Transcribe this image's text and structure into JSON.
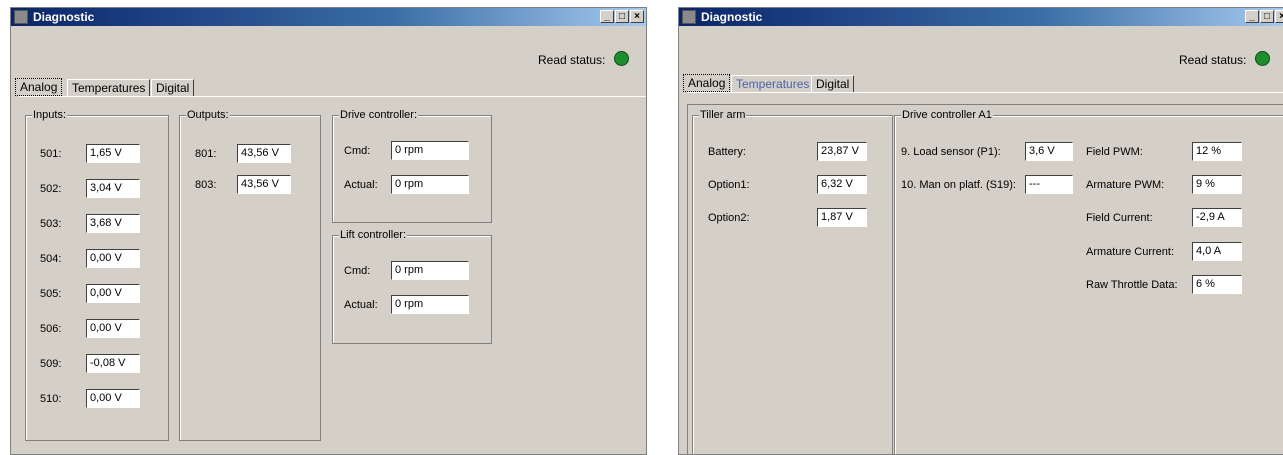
{
  "left": {
    "title": "Diagnostic",
    "read_status_label": "Read status:",
    "status_color": "#1a8f2c",
    "tabs": {
      "analog": "Analog",
      "temperatures": "Temperatures",
      "digital": "Digital"
    },
    "inputs": {
      "title": "Inputs:",
      "rows": [
        {
          "label": "501:",
          "value": "1,65 V"
        },
        {
          "label": "502:",
          "value": "3,04 V"
        },
        {
          "label": "503:",
          "value": "3,68 V"
        },
        {
          "label": "504:",
          "value": "0,00 V"
        },
        {
          "label": "505:",
          "value": "0,00 V"
        },
        {
          "label": "506:",
          "value": "0,00 V"
        },
        {
          "label": "509:",
          "value": "-0,08 V"
        },
        {
          "label": "510:",
          "value": "0,00 V"
        }
      ]
    },
    "outputs": {
      "title": "Outputs:",
      "rows": [
        {
          "label": "801:",
          "value": "43,56 V"
        },
        {
          "label": "803:",
          "value": "43,56 V"
        }
      ]
    },
    "drive_controller": {
      "title": "Drive controller:",
      "cmd_label": "Cmd:",
      "cmd_value": "0 rpm",
      "actual_label": "Actual:",
      "actual_value": "0 rpm"
    },
    "lift_controller": {
      "title": "Lift controller:",
      "cmd_label": "Cmd:",
      "cmd_value": "0 rpm",
      "actual_label": "Actual:",
      "actual_value": "0 rpm"
    }
  },
  "right": {
    "title": "Diagnostic",
    "read_status_label": "Read status:",
    "status_color": "#1a8f2c",
    "tabs": {
      "analog": "Analog",
      "temperatures": "Temperatures",
      "digital": "Digital"
    },
    "tiller_arm": {
      "title": "Tiller arm",
      "rows": [
        {
          "label": "Battery:",
          "value": "23,87 V"
        },
        {
          "label": "Option1:",
          "value": "6,32 V"
        },
        {
          "label": "Option2:",
          "value": "1,87 V"
        }
      ]
    },
    "drive_controller_a1": {
      "title": "Drive controller A1",
      "left_rows": [
        {
          "label": "9. Load sensor (P1):",
          "value": "3,6 V"
        },
        {
          "label": "10. Man on platf. (S19):",
          "value": "---"
        }
      ],
      "right_rows": [
        {
          "label": "Field PWM:",
          "value": "12 %"
        },
        {
          "label": "Armature PWM:",
          "value": "9 %"
        },
        {
          "label": "Field Current:",
          "value": "-2,9 A"
        },
        {
          "label": "Armature Current:",
          "value": "4,0 A"
        },
        {
          "label": "Raw Throttle Data:",
          "value": "6 %"
        }
      ]
    }
  }
}
